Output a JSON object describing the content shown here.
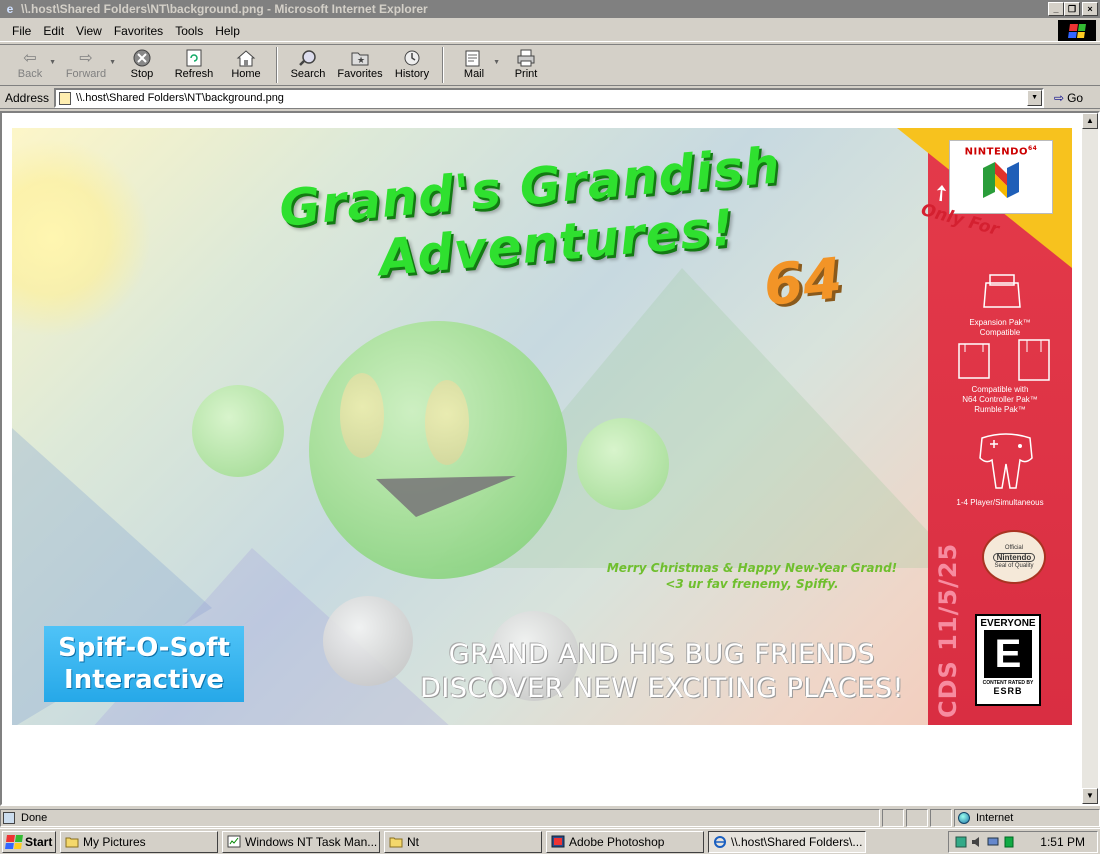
{
  "window": {
    "title": "\\\\.host\\Shared Folders\\NT\\background.png - Microsoft Internet Explorer",
    "controls": {
      "minimize": "_",
      "maximize": "❐",
      "close": "×"
    }
  },
  "menu": [
    "File",
    "Edit",
    "View",
    "Favorites",
    "Tools",
    "Help"
  ],
  "toolbar": {
    "back": "Back",
    "forward": "Forward",
    "stop": "Stop",
    "refresh": "Refresh",
    "home": "Home",
    "search": "Search",
    "favorites": "Favorites",
    "history": "History",
    "mail": "Mail",
    "print": "Print"
  },
  "address": {
    "label": "Address",
    "value": "\\\\.host\\Shared Folders\\NT\\background.png",
    "go": "Go"
  },
  "image": {
    "title_line1": "Grand's Grandish",
    "title_line2": "Adventures!",
    "title_64": "64",
    "message_line1": "Merry Christmas & Happy New-Year Grand!",
    "message_line2": "<3 ur fav frenemy, Spiffy.",
    "tagline_line1": "GRAND AND HIS BUG FRIENDS",
    "tagline_line2": "DISCOVER  NEW EXCITING PLACES!",
    "logo_line1": "Spiff-O-Soft",
    "logo_line2": "Interactive",
    "nintendo_label": "NINTENDO",
    "nintendo_sup": "64",
    "only_for": "Only For",
    "expansion_line1": "Expansion Pak™",
    "expansion_line2": "Compatible",
    "controller_line1": "Compatible with",
    "controller_line2": "N64 Controller Pak™",
    "controller_line3": "Rumble Pak™",
    "players": "1-4 Player/Simultaneous",
    "cds": "CDS 11/5/25",
    "seal_top": "Official",
    "seal_name": "Nintendo",
    "seal_bottom": "Seal of Quality",
    "esrb_rating": "EVERYONE",
    "esrb_letter": "E",
    "esrb_rated": "CONTENT RATED BY",
    "esrb_word": "ESRB"
  },
  "status": {
    "text": "Done",
    "zone": "Internet"
  },
  "taskbar": {
    "start": "Start",
    "tasks": [
      "My Pictures",
      "Windows NT Task Man...",
      "Nt",
      "Adobe Photoshop",
      "\\\\.host\\Shared Folders\\..."
    ],
    "clock": "1:51 PM"
  },
  "colors": {
    "title_green": "#2fe02f",
    "sixtyfour_orange": "#f29427",
    "panel_red": "#e43a4a",
    "message_green": "#6fbf2e",
    "logo_blue": "#26a8e8"
  }
}
